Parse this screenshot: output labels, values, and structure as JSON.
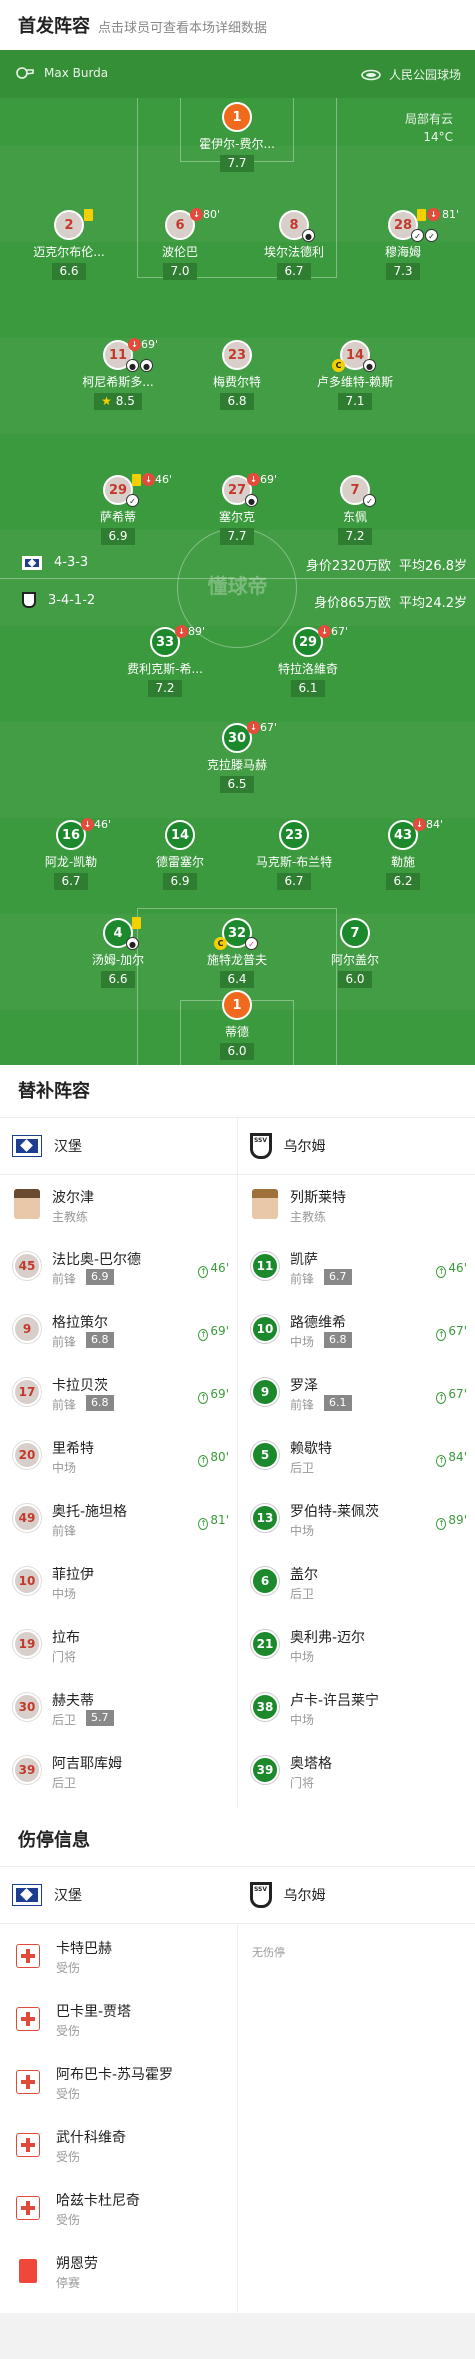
{
  "header": {
    "title": "首发阵容",
    "subtitle": "点击球员可查看本场详细数据"
  },
  "match_info": {
    "referee": "Max Burda",
    "venue": "人民公园球场",
    "weather": "局部有云",
    "temperature": "14°C",
    "watermark": "懂球帝"
  },
  "home_team": {
    "name": "汉堡",
    "formation": "4-3-3",
    "value": "身价2320万欧",
    "avg_age": "平均26.8岁"
  },
  "away_team": {
    "name": "乌尔姆",
    "formation": "3-4-1-2",
    "value": "身价865万欧",
    "avg_age": "平均24.2岁"
  },
  "home_lineup": [
    {
      "num": "1",
      "name": "霍伊尔-费尔...",
      "rating": "7.7"
    },
    {
      "num": "2",
      "name": "迈克尔布伦...",
      "rating": "6.6"
    },
    {
      "num": "6",
      "name": "波伦巴",
      "rating": "7.0",
      "sub_time": "80'"
    },
    {
      "num": "8",
      "name": "埃尔法德利",
      "rating": "6.7"
    },
    {
      "num": "28",
      "name": "穆海姆",
      "rating": "7.3",
      "sub_time": "81'"
    },
    {
      "num": "11",
      "name": "柯尼希斯多...",
      "rating": "8.5",
      "sub_time": "69'"
    },
    {
      "num": "23",
      "name": "梅费尔特",
      "rating": "6.8"
    },
    {
      "num": "14",
      "name": "卢多维特-赖斯",
      "rating": "7.1"
    },
    {
      "num": "29",
      "name": "萨希蒂",
      "rating": "6.9",
      "sub_time": "46'"
    },
    {
      "num": "27",
      "name": "塞尔克",
      "rating": "7.7",
      "sub_time": "69'"
    },
    {
      "num": "7",
      "name": "东佩",
      "rating": "7.2"
    }
  ],
  "away_lineup": [
    {
      "num": "33",
      "name": "费利克斯-希...",
      "rating": "7.2",
      "sub_time": "89'"
    },
    {
      "num": "29",
      "name": "特拉洛維奇",
      "rating": "6.1",
      "sub_time": "67'"
    },
    {
      "num": "30",
      "name": "克拉滕马赫",
      "rating": "6.5",
      "sub_time": "67'"
    },
    {
      "num": "16",
      "name": "阿龙-凯勒",
      "rating": "6.7",
      "sub_time": "46'"
    },
    {
      "num": "14",
      "name": "德雷塞尔",
      "rating": "6.9"
    },
    {
      "num": "23",
      "name": "马克斯-布兰特",
      "rating": "6.7"
    },
    {
      "num": "43",
      "name": "勒施",
      "rating": "6.2",
      "sub_time": "84'"
    },
    {
      "num": "4",
      "name": "汤姆-加尔",
      "rating": "6.6"
    },
    {
      "num": "32",
      "name": "施特龙普夫",
      "rating": "6.4"
    },
    {
      "num": "7",
      "name": "阿尔盖尔",
      "rating": "6.0"
    },
    {
      "num": "1",
      "name": "蒂德",
      "rating": "6.0"
    }
  ],
  "subs": {
    "title": "替补阵容",
    "home_coach": {
      "name": "波尔津",
      "role": "主教练"
    },
    "away_coach": {
      "name": "列斯莱特",
      "role": "主教练"
    },
    "home": [
      {
        "num": "45",
        "name": "法比奥-巴尔德",
        "pos": "前锋",
        "rating": "6.9",
        "time": "46'"
      },
      {
        "num": "9",
        "name": "格拉策尔",
        "pos": "前锋",
        "rating": "6.8",
        "time": "69'"
      },
      {
        "num": "17",
        "name": "卡拉贝茨",
        "pos": "前锋",
        "rating": "6.8",
        "time": "69'"
      },
      {
        "num": "20",
        "name": "里希特",
        "pos": "中场",
        "rating": "",
        "time": "80'"
      },
      {
        "num": "49",
        "name": "奥托-施坦格",
        "pos": "前锋",
        "rating": "",
        "time": "81'"
      },
      {
        "num": "10",
        "name": "菲拉伊",
        "pos": "中场",
        "rating": "",
        "time": ""
      },
      {
        "num": "19",
        "name": "拉布",
        "pos": "门将",
        "rating": "",
        "time": ""
      },
      {
        "num": "30",
        "name": "赫夫蒂",
        "pos": "后卫",
        "rating": "5.7",
        "time": ""
      },
      {
        "num": "39",
        "name": "阿吉耶库姆",
        "pos": "后卫",
        "rating": "",
        "time": ""
      }
    ],
    "away": [
      {
        "num": "11",
        "name": "凯萨",
        "pos": "前锋",
        "rating": "6.7",
        "time": "46'"
      },
      {
        "num": "10",
        "name": "路德维希",
        "pos": "中场",
        "rating": "6.8",
        "time": "67'"
      },
      {
        "num": "9",
        "name": "罗泽",
        "pos": "前锋",
        "rating": "6.1",
        "time": "67'"
      },
      {
        "num": "5",
        "name": "赖歇特",
        "pos": "后卫",
        "rating": "",
        "time": "84'"
      },
      {
        "num": "13",
        "name": "罗伯特-莱佩茨",
        "pos": "中场",
        "rating": "",
        "time": "89'"
      },
      {
        "num": "6",
        "name": "盖尔",
        "pos": "后卫",
        "rating": "",
        "time": ""
      },
      {
        "num": "21",
        "name": "奥利弗-迈尔",
        "pos": "中场",
        "rating": "",
        "time": ""
      },
      {
        "num": "38",
        "name": "卢卡-许吕莱宁",
        "pos": "中场",
        "rating": "",
        "time": ""
      },
      {
        "num": "39",
        "name": "奥塔格",
        "pos": "门将",
        "rating": "",
        "time": ""
      }
    ]
  },
  "injuries": {
    "title": "伤停信息",
    "home": [
      {
        "name": "卡特巴赫",
        "status": "受伤",
        "icon": "medical-kit-icon"
      },
      {
        "name": "巴卡里-贾塔",
        "status": "受伤",
        "icon": "medical-kit-icon"
      },
      {
        "name": "阿布巴卡-苏马霍罗",
        "status": "受伤",
        "icon": "medical-kit-icon"
      },
      {
        "name": "武什科维奇",
        "status": "受伤",
        "icon": "medical-kit-icon"
      },
      {
        "name": "哈兹卡杜尼奇",
        "status": "受伤",
        "icon": "medical-kit-icon"
      },
      {
        "name": "朔恩劳",
        "status": "停赛",
        "icon": "red-card-icon"
      }
    ],
    "away_empty": "无伤停"
  },
  "colors": {
    "pitch": "#3c9a3e",
    "home_circle": "#d9cfca",
    "away_circle": "#1c8a2c",
    "gk": "#f06a1d",
    "sub_green": "#3a9a3a"
  }
}
